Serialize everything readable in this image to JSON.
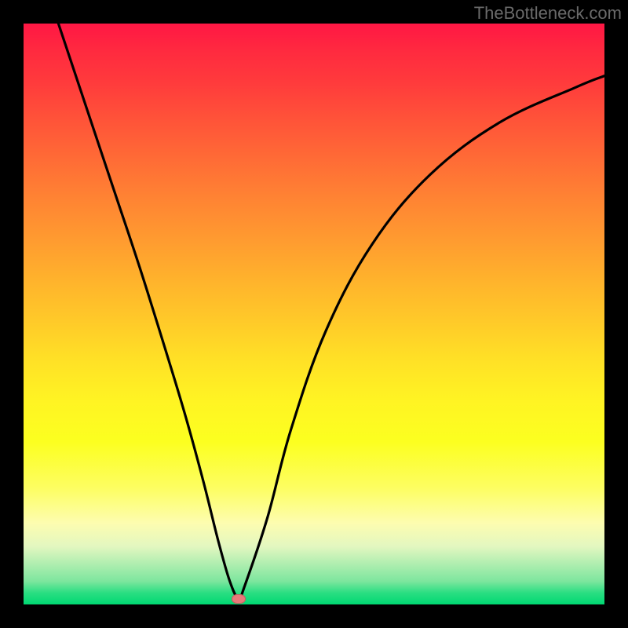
{
  "watermark": "TheBottleneck.com",
  "chart_data": {
    "type": "line",
    "title": "",
    "xlabel": "",
    "ylabel": "",
    "xlim": [
      0,
      100
    ],
    "ylim": [
      0,
      100
    ],
    "grid": false,
    "series": [
      {
        "name": "curve",
        "x": [
          6,
          10,
          15,
          20,
          25,
          28,
          31,
          33.5,
          35.5,
          37,
          38,
          42,
          46,
          52,
          60,
          70,
          82,
          95,
          100
        ],
        "values": [
          100,
          88,
          73,
          58,
          42,
          32,
          21,
          11,
          4,
          1,
          3,
          15,
          30,
          47,
          62,
          74,
          83,
          89,
          91
        ]
      }
    ],
    "markers": [
      {
        "name": "optimum-marker",
        "x": 37,
        "y": 1
      }
    ],
    "background": {
      "type": "vertical-gradient",
      "stops": [
        {
          "pos": 0,
          "color": "#ff1744"
        },
        {
          "pos": 50,
          "color": "#ffc929"
        },
        {
          "pos": 72,
          "color": "#fcff20"
        },
        {
          "pos": 100,
          "color": "#00d872"
        }
      ]
    }
  }
}
